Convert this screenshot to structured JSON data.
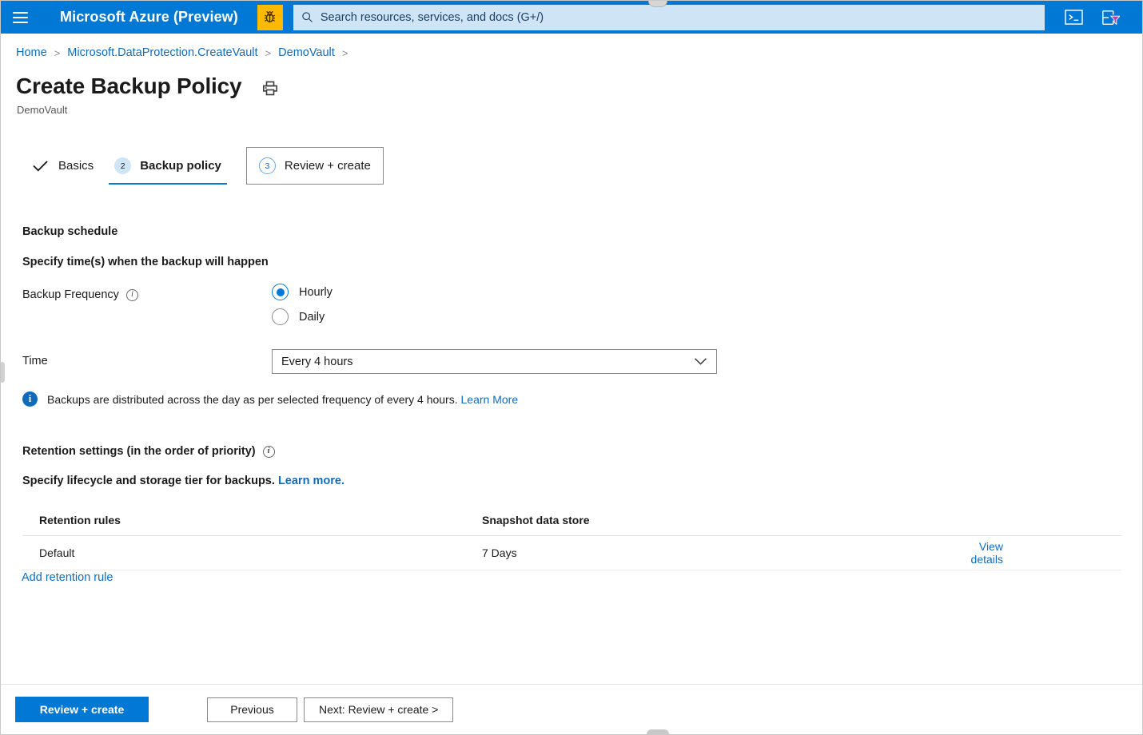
{
  "topbar": {
    "menu_icon": "hamburger-icon",
    "brand": "Microsoft Azure (Preview)",
    "bug_icon": "bug-icon",
    "search": {
      "icon": "search-icon",
      "placeholder": "Search resources, services, and docs (G+/)"
    },
    "icons": [
      {
        "name": "cloud-shell-icon"
      },
      {
        "name": "directory-filter-icon"
      }
    ],
    "accent_color": "#0078d4",
    "bug_badge_color": "#ffb900",
    "search_bg": "#cfe4f5"
  },
  "breadcrumb": {
    "items": [
      "Home",
      "Microsoft.DataProtection.CreateVault",
      "DemoVault"
    ],
    "separator": ">",
    "link_color": "#0f6cbd"
  },
  "header": {
    "title": "Create Backup Policy",
    "print_icon": "print-icon",
    "subtitle": "DemoVault"
  },
  "tabs": [
    {
      "label": "Basics",
      "state": "done",
      "badge": "check-icon"
    },
    {
      "label": "Backup policy",
      "state": "active",
      "badge": "2"
    },
    {
      "label": "Review + create",
      "state": "upcoming",
      "badge": "3"
    }
  ],
  "schedule": {
    "section_title": "Backup schedule",
    "sub_title": "Specify time(s) when the backup will happen",
    "frequency_label": "Backup Frequency",
    "frequency_info_icon": "info-icon",
    "frequency_options": [
      {
        "label": "Hourly",
        "selected": true
      },
      {
        "label": "Daily",
        "selected": false
      }
    ],
    "time_label": "Time",
    "time_value": "Every 4 hours",
    "time_chevron_icon": "chevron-down-icon",
    "info_icon": "info-filled-icon",
    "info_text": "Backups are distributed across the day as per selected frequency of every 4 hours.",
    "info_link": "Learn More"
  },
  "retention": {
    "section_title": "Retention settings (in the order of priority)",
    "section_info_icon": "info-icon",
    "sub_text": "Specify lifecycle and storage tier for backups.",
    "sub_link": "Learn more.",
    "columns": [
      "Retention rules",
      "Snapshot data store",
      ""
    ],
    "rows": [
      {
        "rule": "Default",
        "snapshot": "7 Days",
        "action": "View details"
      }
    ],
    "add_rule_label": "Add retention rule"
  },
  "footer": {
    "primary": "Review + create",
    "previous": "Previous",
    "next": "Next: Review + create >"
  }
}
